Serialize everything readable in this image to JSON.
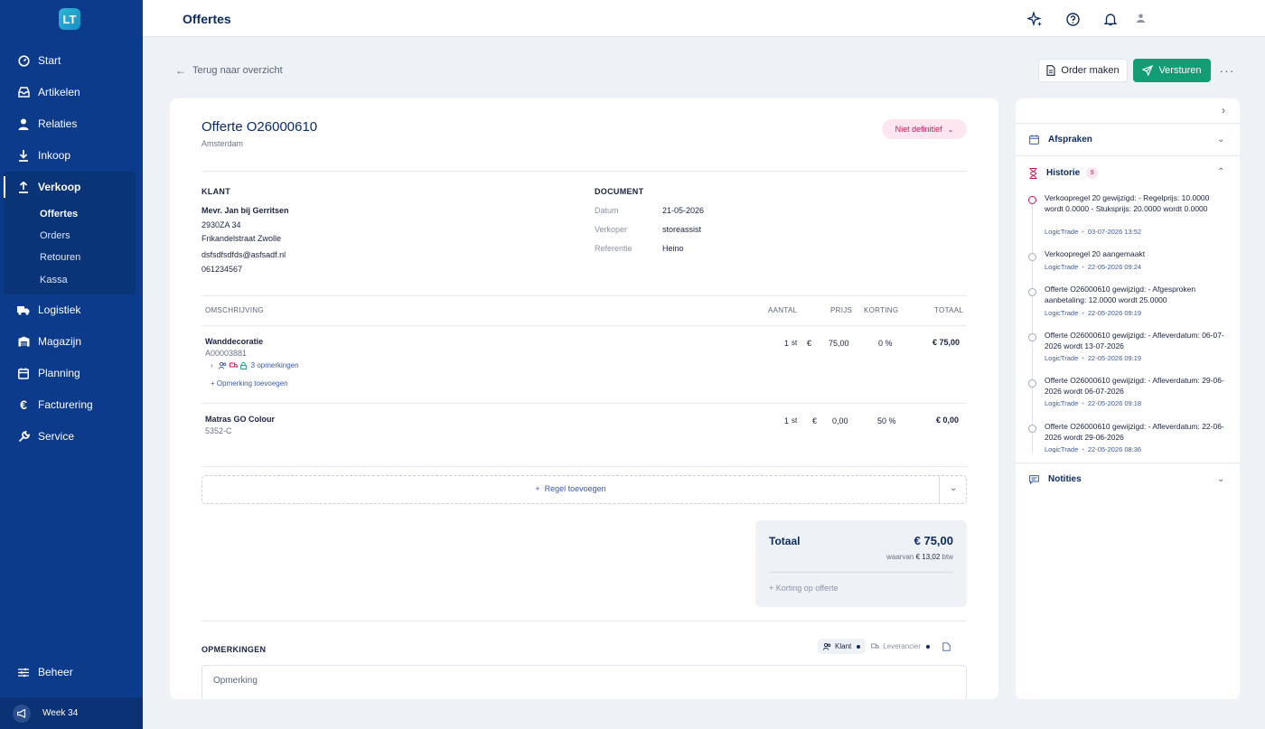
{
  "app": {
    "logo_text": "LT",
    "page_title": "Offertes"
  },
  "sidebar": {
    "items": [
      {
        "label": "Start",
        "icon": "dashboard-icon"
      },
      {
        "label": "Artikelen",
        "icon": "inbox-icon"
      },
      {
        "label": "Relaties",
        "icon": "user-icon"
      },
      {
        "label": "Inkoop",
        "icon": "download-icon"
      },
      {
        "label": "Verkoop",
        "icon": "upload-icon"
      },
      {
        "label": "Logistiek",
        "icon": "truck-icon"
      },
      {
        "label": "Magazijn",
        "icon": "warehouse-icon"
      },
      {
        "label": "Planning",
        "icon": "calendar-icon"
      },
      {
        "label": "Facturering",
        "icon": "euro-icon"
      },
      {
        "label": "Service",
        "icon": "wrench-icon"
      }
    ],
    "sub_items": [
      "Offertes",
      "Orders",
      "Retouren",
      "Kassa"
    ],
    "beheer": "Beheer",
    "week": "Week 34"
  },
  "actions": {
    "back": "Terug naar overzicht",
    "order": "Order maken",
    "send": "Versturen"
  },
  "offer": {
    "title": "Offerte O26000610",
    "location": "Amsterdam",
    "status": "Niet definitief"
  },
  "customer": {
    "label": "KLANT",
    "name": "Mevr. Jan bij Gerritsen",
    "postal": "2930ZA 34",
    "street": "Frikandelstraat Zwolle",
    "email": "dsfsdfsdfds@asfsadf.nl",
    "phone": "061234567"
  },
  "document": {
    "label": "DOCUMENT",
    "fields": [
      {
        "key": "Datum",
        "value": "21-05-2026"
      },
      {
        "key": "Verkoper",
        "value": "storeassist"
      },
      {
        "key": "Referentie",
        "value": "Heino"
      }
    ]
  },
  "table": {
    "headers": {
      "desc": "OMSCHRIJVING",
      "qty": "AANTAL",
      "price": "PRIJS",
      "discount": "KORTING",
      "total": "TOTAAL"
    },
    "rows": [
      {
        "title": "Wanddecoratie",
        "code": "A00003881",
        "qty": "1",
        "unit": "st",
        "currency": "€",
        "price": "75,00",
        "discount": "0 %",
        "total": "€ 75,00",
        "remarks": "3 opmerkingen",
        "add_remark": "+ Opmerking toevoegen"
      },
      {
        "title": "Matras GO Colour",
        "code": "5352-C",
        "qty": "1",
        "unit": "st",
        "currency": "€",
        "price": "0,00",
        "discount": "50 %",
        "total": "€ 0,00"
      }
    ],
    "add_rule": "Regel toevoegen"
  },
  "totals": {
    "label": "Totaal",
    "amount": "€ 75,00",
    "vat_prefix": "waarvan",
    "vat_amount": "€ 13,02",
    "vat_suffix": "btw",
    "discount_action": "+ Korting op offerte"
  },
  "remarks": {
    "label": "OPMERKINGEN",
    "tab_customer": "Klant",
    "tab_supplier": "Leverancier",
    "placeholder": "Opmerking"
  },
  "right_panel": {
    "appointments": "Afspraken",
    "history": "Historie",
    "history_count": "9",
    "notes": "Notities",
    "history_items": [
      {
        "text": "Verkoopregel 20 gewijzigd: - Regelprijs: 10.0000 wordt 0.0000 - Stuksprijs: 20.0000 wordt 0.0000",
        "user": "LogicTrade",
        "date": "03-07-2026 13:52"
      },
      {
        "text": "Verkoopregel 20 aangemaakt",
        "user": "LogicTrade",
        "date": "22-05-2026 09:24"
      },
      {
        "text": "Offerte O26000610 gewijzigd: - Afgesproken aanbetaling: 12.0000 wordt 25.0000",
        "user": "LogicTrade",
        "date": "22-05-2026 09:19"
      },
      {
        "text": "Offerte O26000610 gewijzigd: - Afleverdatum: 06-07-2026 wordt 13-07-2026",
        "user": "LogicTrade",
        "date": "22-05-2026 09:19"
      },
      {
        "text": "Offerte O26000610 gewijzigd: - Afleverdatum: 29-06-2026 wordt 06-07-2026",
        "user": "LogicTrade",
        "date": "22-05-2026 09:18"
      },
      {
        "text": "Offerte O26000610 gewijzigd: - Afleverdatum: 22-06-2026 wordt 29-06-2026",
        "user": "LogicTrade",
        "date": "22-05-2026 08:36"
      }
    ]
  },
  "colors": {
    "sidebar": "#0c3b8c",
    "accent_green": "#149c77",
    "status_pink": "#c2185b",
    "text_navy": "#0c2b63"
  }
}
